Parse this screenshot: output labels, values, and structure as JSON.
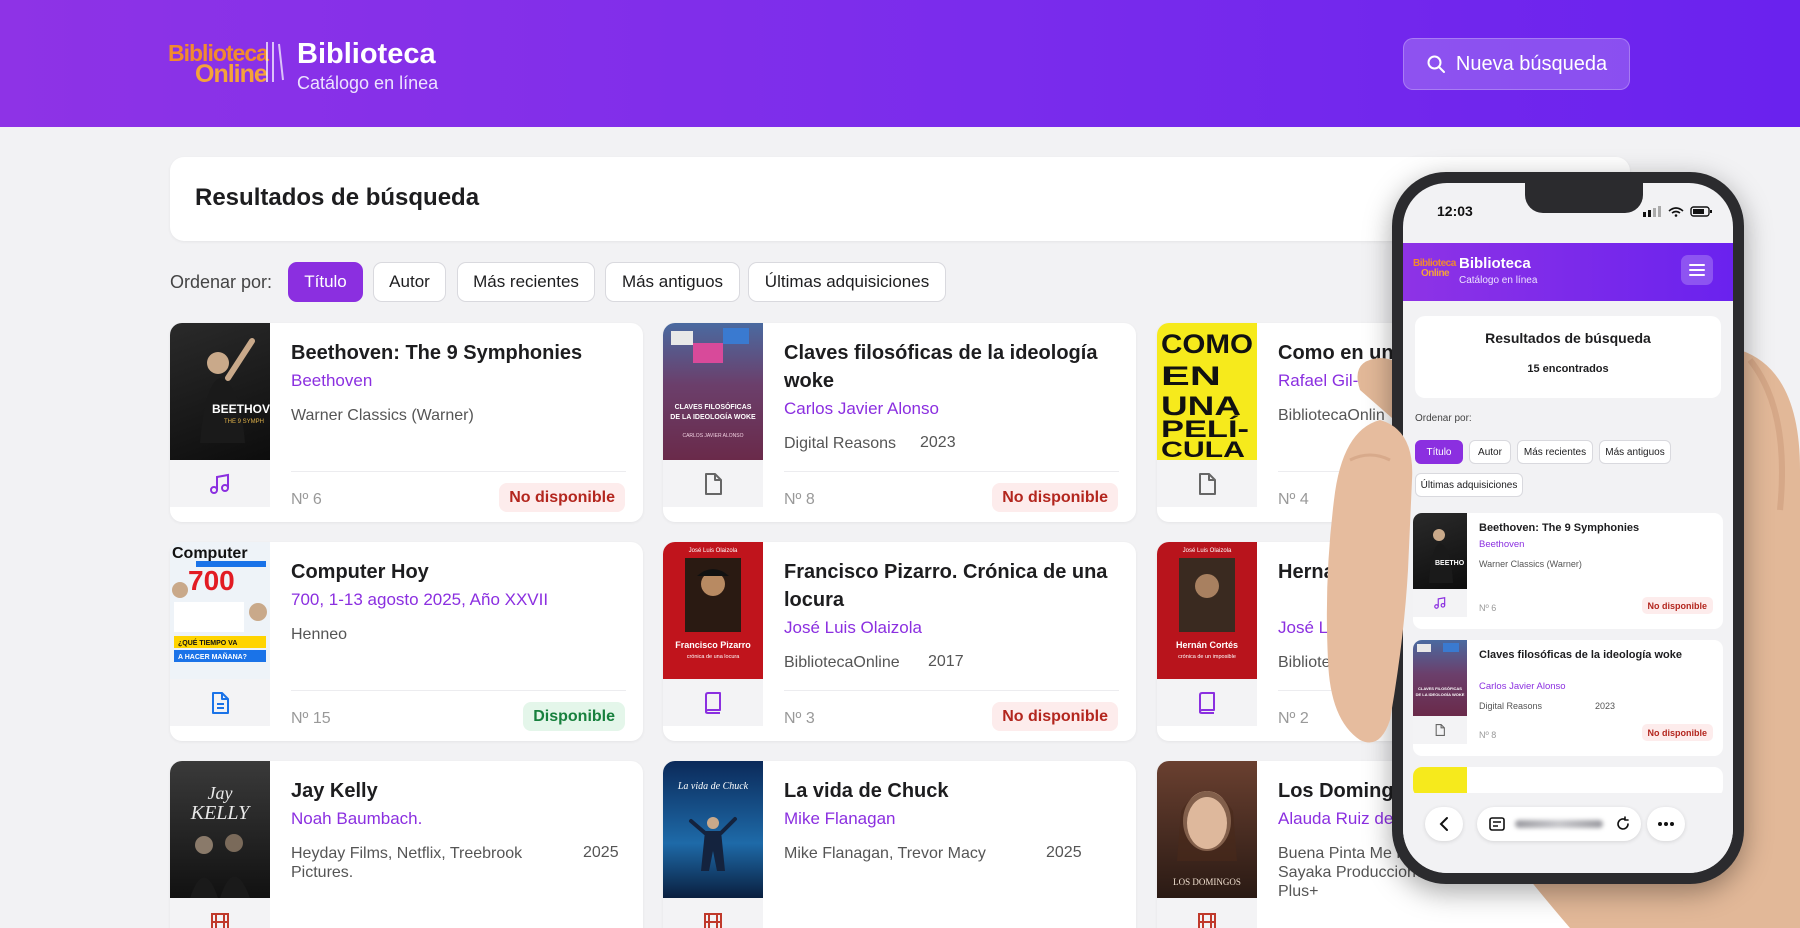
{
  "header": {
    "logo_line1": "Biblioteca",
    "logo_line2": "Online",
    "title": "Biblioteca",
    "subtitle": "Catálogo en línea",
    "new_search_label": "Nueva búsqueda",
    "gradient_start": "#8e33e6",
    "gradient_end": "#6a22ee"
  },
  "results": {
    "title": "Resultados de búsqueda"
  },
  "sort": {
    "label": "Ordenar por:",
    "options": [
      "Título",
      "Autor",
      "Más recientes",
      "Más antiguos",
      "Últimas adquisiciones"
    ],
    "active": "Título"
  },
  "accent_color": "#8b2fe0",
  "items": [
    {
      "title": "Beethoven: The 9 Symphonies",
      "author": "Beethoven",
      "publisher": "Warner Classics (Warner)",
      "year": "",
      "number": "Nº 6",
      "status": "No disponible",
      "type_icon": "music-icon",
      "cover_text": "BEETHOVEN"
    },
    {
      "title": "Claves filosóficas de la ideología woke",
      "author": "Carlos Javier Alonso",
      "publisher": "Digital Reasons",
      "year": "2023",
      "number": "Nº 8",
      "status": "No disponible",
      "type_icon": "document-icon",
      "cover_text": "CLAVES FILOSÓFICAS DE LA IDEOLOGÍA WOKE"
    },
    {
      "title": "Como en una",
      "author": "Rafael Gil-Nog",
      "publisher": "BibliotecaOnlin",
      "year": "",
      "number": "Nº 4",
      "status": "",
      "type_icon": "document-icon",
      "cover_text": "COMO EN UNA PELÍ-CULA"
    },
    {
      "title": "Computer Hoy",
      "author": "700, 1-13 agosto 2025, Año XXVII",
      "publisher": "Henneo",
      "year": "",
      "number": "Nº 15",
      "status": "Disponible",
      "type_icon": "magazine-icon",
      "cover_text": "Computer 700"
    },
    {
      "title": "Francisco Pizarro. Crónica de una locura",
      "author": "José Luis Olaizola",
      "publisher": "BibliotecaOnline",
      "year": "2017",
      "number": "Nº 3",
      "status": "No disponible",
      "type_icon": "book-icon",
      "cover_text": "Francisco Pizarro"
    },
    {
      "title": "Herna impos",
      "author": "José Luis",
      "publisher": "BibliotecaOnlin",
      "year": "",
      "number": "Nº 2",
      "status": "",
      "type_icon": "book-icon",
      "cover_text": "Hernán Cortés"
    },
    {
      "title": "Jay Kelly",
      "author": "Noah Baumbach.",
      "publisher": "Heyday Films, Netflix, Treebrook Pictures.",
      "year": "2025",
      "number": "",
      "status": "",
      "type_icon": "film-icon",
      "cover_text": "Jay Kelly"
    },
    {
      "title": "La vida de Chuck",
      "author": "Mike Flanagan",
      "publisher": "Mike Flanagan, Trevor Macy",
      "year": "2025",
      "number": "",
      "status": "",
      "type_icon": "film-icon",
      "cover_text": "La vida de Chuck"
    },
    {
      "title": "Los Doming",
      "author": "Alauda Ruiz de",
      "publisher": "Buena Pinta Me Producciones, Sayaka Producciones, Movistar Plus+",
      "year": "",
      "number": "",
      "status": "",
      "type_icon": "film-icon",
      "cover_text": "LOS DOMINGOS"
    }
  ],
  "mobile": {
    "time": "12:03",
    "title": "Biblioteca",
    "subtitle": "Catálogo en línea",
    "results_title": "Resultados de búsqueda",
    "count": "15 encontrados",
    "sort_label": "Ordenar por:",
    "sort_options": [
      "Título",
      "Autor",
      "Más recientes",
      "Más antiguos",
      "Últimas adquisiciones"
    ],
    "items": [
      {
        "title": "Beethoven: The 9 Symphonies",
        "author": "Beethoven",
        "publisher": "Warner Classics (Warner)",
        "year": "",
        "number": "Nº 6",
        "status": "No disponible"
      },
      {
        "title": "Claves filosóficas de la ideología woke",
        "author": "Carlos Javier Alonso",
        "publisher": "Digital Reasons",
        "year": "2023",
        "number": "Nº 8",
        "status": "No disponible"
      }
    ]
  }
}
